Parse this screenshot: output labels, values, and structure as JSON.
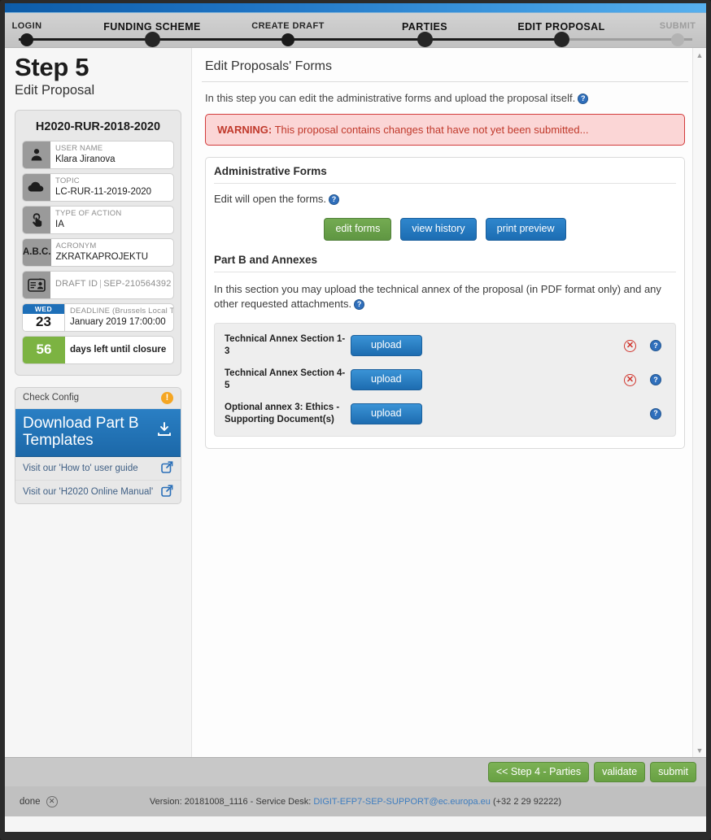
{
  "stepper": {
    "steps": [
      {
        "label": "LOGIN",
        "state": "done"
      },
      {
        "label": "FUNDING SCHEME",
        "state": "done"
      },
      {
        "label": "CREATE DRAFT",
        "state": "done"
      },
      {
        "label": "PARTIES",
        "state": "active"
      },
      {
        "label": "EDIT PROPOSAL",
        "state": "active"
      },
      {
        "label": "SUBMIT",
        "state": "disabled"
      }
    ]
  },
  "sidebar": {
    "step_title": "Step 5",
    "step_subtitle": "Edit Proposal",
    "card_title": "H2020-RUR-2018-2020",
    "info_rows": [
      {
        "icon": "user-icon",
        "key": "USER NAME",
        "value": "Klara Jiranova"
      },
      {
        "icon": "cloud-icon",
        "key": "TOPIC",
        "value": "LC-RUR-11-2019-2020"
      },
      {
        "icon": "hand-click-icon",
        "key": "TYPE OF ACTION",
        "value": "IA"
      },
      {
        "icon": "abc-icon",
        "key": "ACRONYM",
        "value": "ZKRATKAPROJEKTU"
      }
    ],
    "draft_row": {
      "icon": "id-card-icon",
      "key": "DRAFT ID",
      "value": "SEP-210564392"
    },
    "deadline_row": {
      "icon": "calendar-icon",
      "weekday": "WED",
      "day": "23",
      "key": "DEADLINE (Brussels Local Time)",
      "value": "January 2019 17:00:00"
    },
    "days_row": {
      "count": "56",
      "label": "days left until closure"
    },
    "links": {
      "check_config": "Check Config",
      "download_title": "Download Part B Templates",
      "how_to": "Visit our 'How to' user guide",
      "manual": "Visit our 'H2020 Online Manual'"
    }
  },
  "main": {
    "page_title": "Edit Proposals' Forms",
    "intro": "In this step you can edit the administrative forms and upload the proposal itself.",
    "warning_label": "WARNING:",
    "warning_text": "This proposal contains changes that have not yet been submitted...",
    "admin_section": {
      "title": "Administrative Forms",
      "lead": "Edit will open the forms.",
      "buttons": [
        {
          "label": "edit forms",
          "style": "green"
        },
        {
          "label": "view history",
          "style": "blue"
        },
        {
          "label": "print preview",
          "style": "blue"
        }
      ]
    },
    "annex_section": {
      "title": "Part B and Annexes",
      "lead": "In this section you may upload the technical annex of the proposal (in PDF format only) and any other requested attachments.",
      "upload_label": "upload",
      "rows": [
        {
          "name": "Technical Annex Section 1-3",
          "has_delete": true
        },
        {
          "name": "Technical Annex Section 4-5",
          "has_delete": true
        },
        {
          "name": "Optional annex 3: Ethics - Supporting Document(s)",
          "has_delete": false
        }
      ]
    }
  },
  "action_bar": {
    "buttons": [
      {
        "label": "<< Step 4 - Parties"
      },
      {
        "label": "validate"
      },
      {
        "label": "submit"
      }
    ]
  },
  "status_bar": {
    "state": "done",
    "version_prefix": "Version: 20181008_1116 - Service Desk: ",
    "email": "DIGIT-EFP7-SEP-SUPPORT@ec.europa.eu",
    "phone": " (+32 2 29 92222)"
  },
  "colors": {
    "accent_blue": "#1c68a8",
    "green": "#5f9642",
    "warning_red": "#c0392b",
    "warning_bg": "#fbd6d6",
    "days_green": "#7cb342"
  }
}
